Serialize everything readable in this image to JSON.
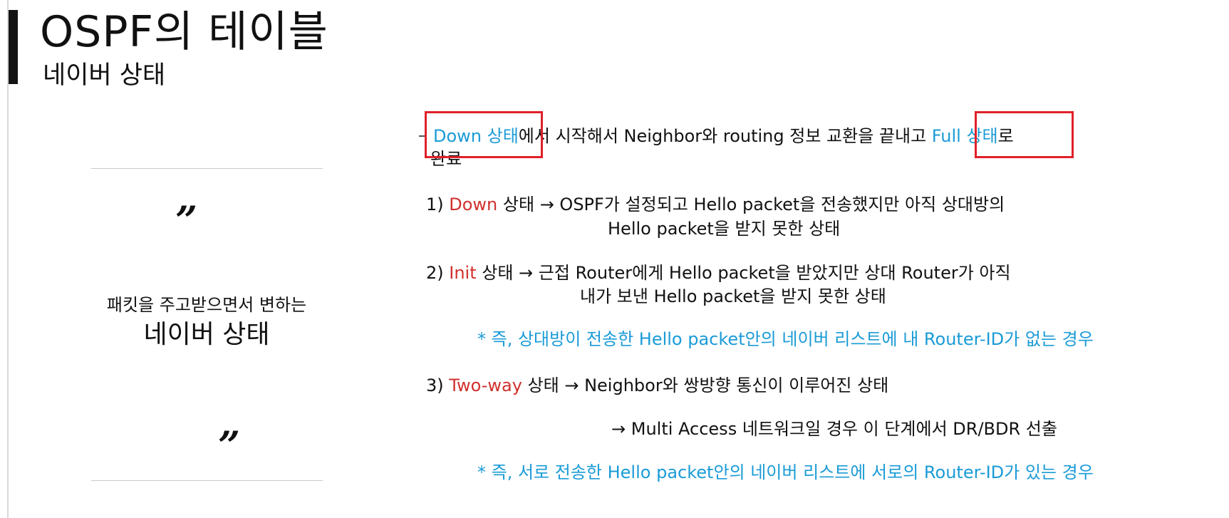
{
  "header": {
    "title": "OSPF의 테이블",
    "subtitle": "네이버 상태"
  },
  "left_panel": {
    "open_quote": "”",
    "close_quote": "”",
    "caption_line1": "패킷을 주고받으면서 변하는",
    "caption_line2": "네이버 상태"
  },
  "intro": {
    "down_state": "Down 상태",
    "middle": "에서 시작해서 Neighbor와 routing 정보 교환을 끝내고 ",
    "full_state": "Full 상태",
    "end": "로",
    "line2": "완료"
  },
  "step1": {
    "number": "1) ",
    "state": "Down",
    "desc": " 상태 → OSPF가 설정되고 Hello packet을 전송했지만 아직 상대방의",
    "desc2": "Hello packet을 받지 못한 상태"
  },
  "step2": {
    "number": "2) ",
    "state": "Init",
    "desc": " 상태 → 근접 Router에게 Hello packet을 받았지만 상대 Router가 아직",
    "desc2": "내가 보낸 Hello packet을 받지 못한 상태",
    "note": "* 즉, 상대방이 전송한 Hello packet안의 네이버 리스트에 내 Router-ID가 없는 경우"
  },
  "step3": {
    "number": "3) ",
    "state": "Two-way",
    "desc": " 상태 → Neighbor와 쌍방향 통신이 이루어진 상태",
    "desc2": "→ Multi Access 네트워크일 경우 이 단계에서 DR/BDR 선출",
    "note": "* 즉, 서로 전송한 Hello packet안의 네이버 리스트에 서로의 Router-ID가 있는 경우"
  },
  "colors": {
    "accent_blue": "#1a9bd7",
    "state_red": "#d0312d",
    "highlight_box": "#e0202a"
  }
}
